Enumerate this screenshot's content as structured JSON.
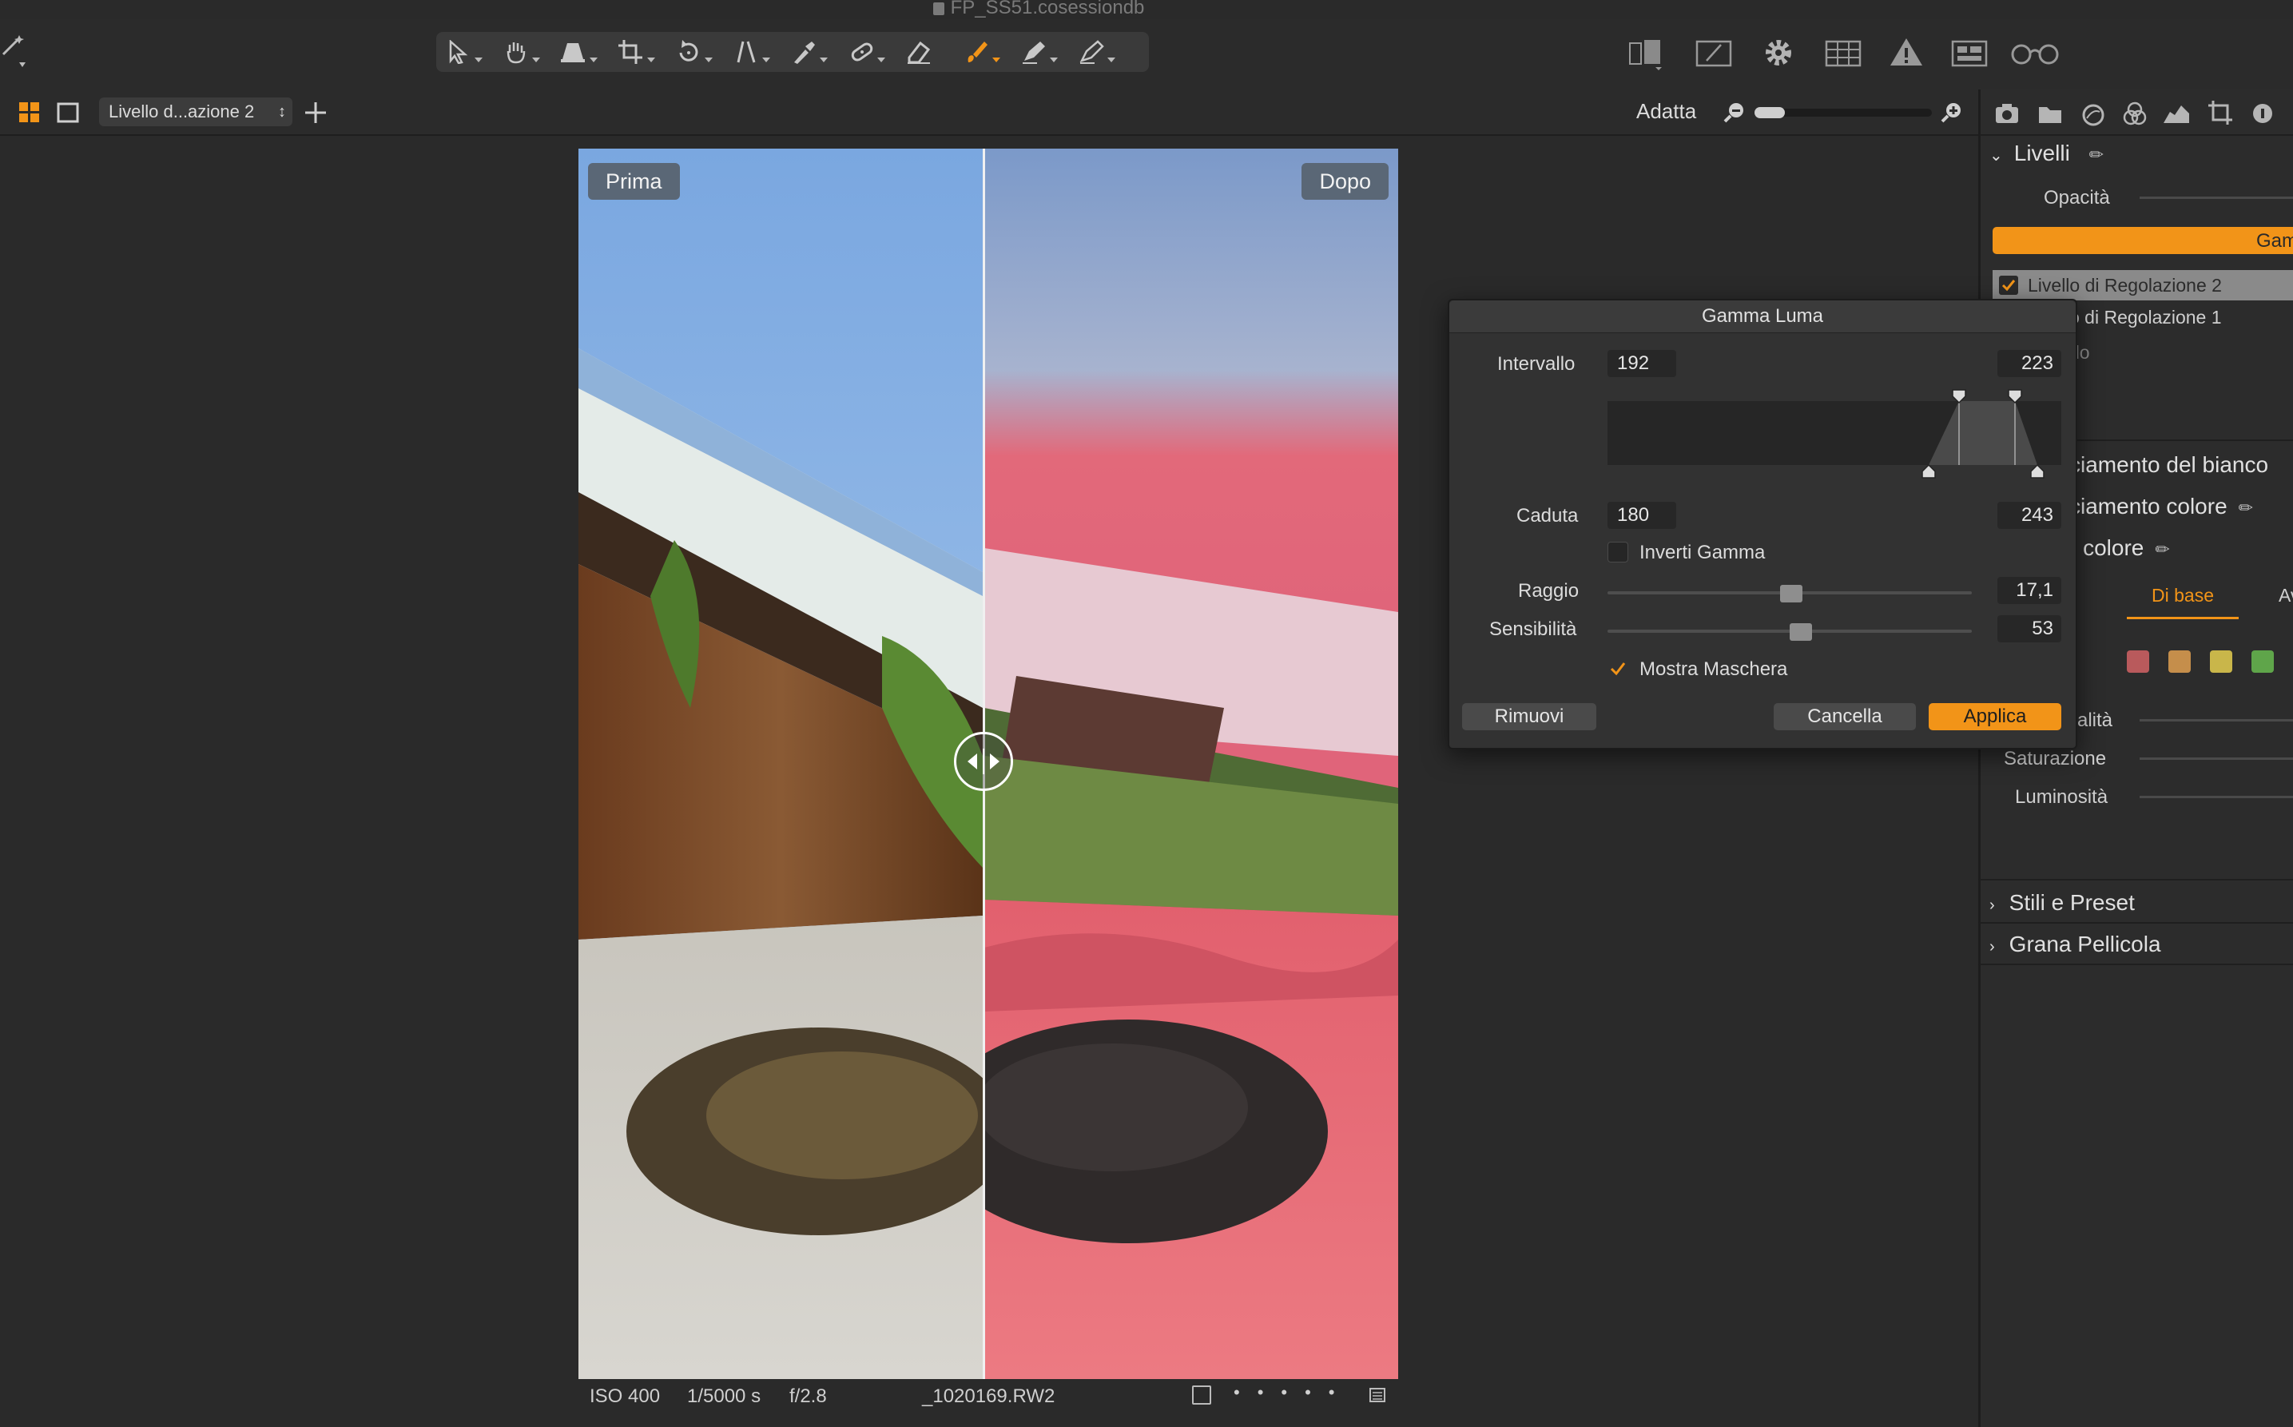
{
  "window": {
    "title": "FP_SS51.cosessiondb"
  },
  "toolbar": {
    "tools": [
      "select-cursor-icon",
      "pan-hand-icon",
      "keystone-icon",
      "crop-icon",
      "rotate-icon",
      "straighten-icon",
      "picker-icon",
      "heal-icon",
      "eraser-icon",
      "brush-icon",
      "draw-mask-icon",
      "pen-icon"
    ],
    "active_tool": "brush-icon",
    "right_icons": [
      "compare-icon",
      "edit-icon",
      "settings-gear-icon",
      "grid-icon",
      "warning-icon",
      "layout-icon",
      "glasses-icon"
    ]
  },
  "viewer_bar": {
    "layer_select": "Livello d...azione 2",
    "zoom_label": "Adatta",
    "zoom_level": 0.17
  },
  "viewer": {
    "before_label": "Prima",
    "after_label": "Dopo",
    "split_position": 0.49
  },
  "status": {
    "iso": "ISO 400",
    "shutter": "1/5000 s",
    "aperture": "f/2.8",
    "filename": "_1020169.RW2"
  },
  "panel": {
    "tabs": [
      "camera-icon",
      "folder-icon",
      "circle-icon",
      "color-wheels-icon",
      "histogram-icon",
      "crop-tab-icon",
      "info-icon"
    ],
    "layers": {
      "title": "Livelli",
      "opacity_label": "Opacità",
      "active_button": "Gam",
      "items": [
        "Livello di Regolazione 2",
        "o di Regolazione 1",
        "do"
      ]
    },
    "sections": [
      "ciamento del bianco",
      "ciamento colore",
      "r colore"
    ],
    "color_tab": "Di base",
    "color_tab_right": "Av",
    "swatches": [
      "#b95a5c",
      "#c58e4b",
      "#c9b64a",
      "#5fa54a"
    ],
    "sliders": [
      "alità",
      "Saturazione",
      "Luminosità"
    ],
    "footer_sections": [
      "Stili e Preset",
      "Grana Pellicola"
    ]
  },
  "dialog": {
    "title": "Gamma Luma",
    "interval_label": "Intervallo",
    "interval_low": "192",
    "interval_high": "223",
    "falloff_label": "Caduta",
    "falloff_low": "180",
    "falloff_high": "243",
    "invert_label": "Inverti Gamma",
    "invert_checked": false,
    "radius_label": "Raggio",
    "radius_value": "17,1",
    "radius_pos": 0.5,
    "sensitivity_label": "Sensibilità",
    "sensitivity_value": "53",
    "sensitivity_pos": 0.53,
    "mask_label": "Mostra Maschera",
    "mask_checked": true,
    "remove_label": "Rimuovi",
    "cancel_label": "Cancella",
    "apply_label": "Applica"
  },
  "colors": {
    "accent": "#f29418",
    "mask": "#e8616f",
    "background": "#2a2a2a"
  }
}
